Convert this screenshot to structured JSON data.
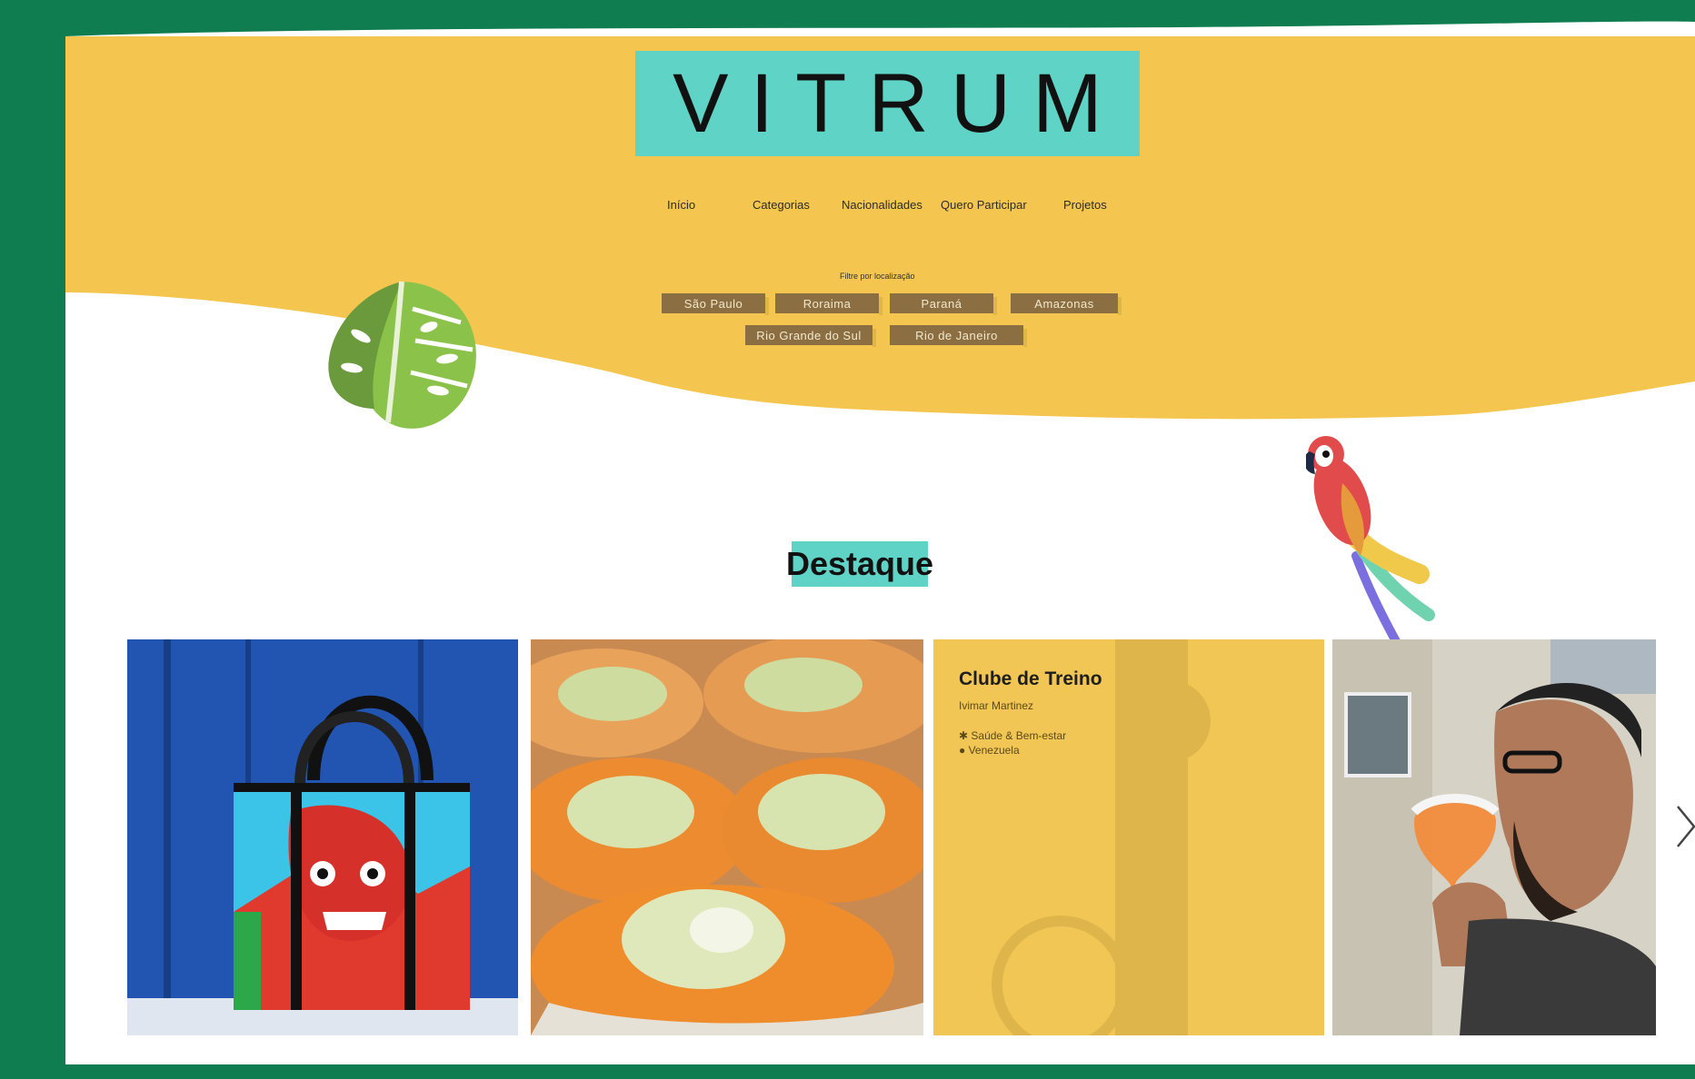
{
  "brand": {
    "logo": "VITRUM"
  },
  "nav": {
    "items": [
      "Início",
      "Categorias",
      "Nacionalidades",
      "Quero Participar",
      "Projetos"
    ]
  },
  "filter": {
    "title": "Filtre por localização",
    "locations": [
      "São Paulo",
      "Roraima",
      "Paraná",
      "Amazonas",
      "Rio Grande do Sul",
      "Rio de Janeiro"
    ]
  },
  "featured": {
    "title": "Destaque",
    "cards": [
      {
        "type": "image",
        "subject": "tote-bag-mask-photo"
      },
      {
        "type": "image",
        "subject": "carrot-tostadas-photo"
      },
      {
        "type": "info",
        "title": "Clube de Treino",
        "author": "Ivimar Martinez",
        "category_icon": "asterisk-icon",
        "category": "Saúde & Bem-estar",
        "nationality_icon": "globe-icon",
        "nationality": "Venezuela"
      },
      {
        "type": "image",
        "subject": "man-tasting-beer-photo"
      }
    ],
    "next_icon": "chevron-right-icon"
  },
  "colors": {
    "frame": "#0f7d50",
    "header": "#f4c64f",
    "accent": "#5fd3c6",
    "chip": "#8b6f42"
  },
  "decorations": [
    "monstera-leaf-icon",
    "parrot-icon"
  ]
}
